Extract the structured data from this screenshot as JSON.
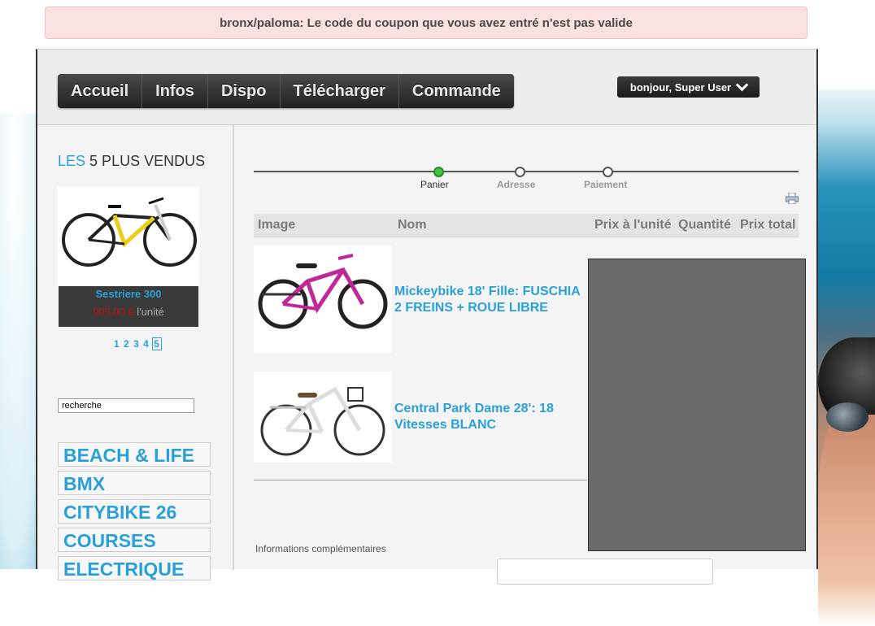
{
  "alert": {
    "message": "bronx/paloma: Le code du coupon que vous avez entré n'est pas valide"
  },
  "nav": {
    "items": [
      "Accueil",
      "Infos",
      "Dispo",
      "Télécharger",
      "Commande"
    ]
  },
  "user_menu": {
    "label": "bonjour, Super User",
    "icon": "chevron-down-icon"
  },
  "sidebar": {
    "title_prefix": "LES",
    "title_rest": "5 PLUS VENDUS",
    "bestseller": {
      "name": "Sestriere 300",
      "price": "905,00 €",
      "unit": "l'unité"
    },
    "pager": {
      "pages": [
        "1",
        "2",
        "3",
        "4"
      ],
      "current": "5"
    },
    "search_value": "recherche",
    "categories": [
      "BEACH & LIFE",
      "BMX",
      "CITYBIKE 26",
      "COURSES",
      "ELECTRIQUE"
    ]
  },
  "checkout": {
    "steps": [
      "Panier",
      "Adresse",
      "Paiement"
    ],
    "active_step": "Panier",
    "columns": {
      "image": "Image",
      "name": "Nom",
      "unit_price": "Prix à l'unité",
      "quantity": "Quantité",
      "total": "Prix total"
    },
    "items": [
      {
        "name": "Mickeybike 18' Fille: FUSCHIA 2 FREINS + ROUE LIBRE"
      },
      {
        "name": "Central Park Dame 28': 18 Vitesses BLANC"
      }
    ],
    "info_label": "Informations complémentaires"
  },
  "colors": {
    "accent": "#2aa0d8",
    "alert_bg": "#fbe1e1",
    "nav_bg": "#2a2a2a",
    "active_step": "#3bc63b"
  }
}
